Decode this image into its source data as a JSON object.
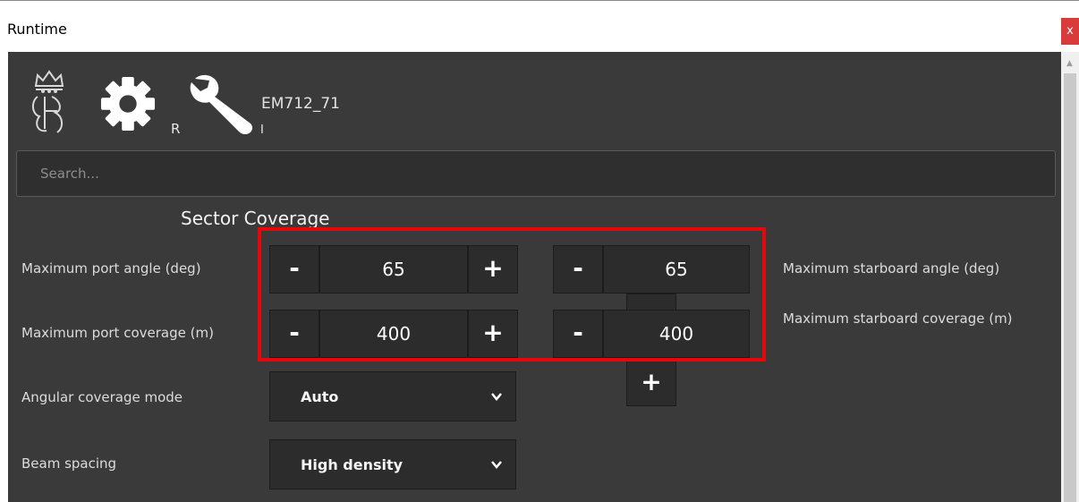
{
  "window": {
    "title": "Runtime",
    "close_label": "x"
  },
  "header": {
    "gear_sub": "R",
    "wrench_sub": "I",
    "device_name": "EM712_71"
  },
  "search": {
    "placeholder": "Search..."
  },
  "section": {
    "title": "Sector Coverage"
  },
  "port_angle": {
    "label": "Maximum port angle (deg)",
    "value": "65"
  },
  "starboard_angle": {
    "label": "Maximum starboard angle (deg)",
    "value": "65"
  },
  "port_coverage": {
    "label": "Maximum port coverage (m)",
    "value": "400"
  },
  "starboard_coverage": {
    "label": "Maximum starboard coverage (m)",
    "value": "400"
  },
  "angular_mode": {
    "label": "Angular coverage mode",
    "value": "Auto"
  },
  "beam_spacing": {
    "label": "Beam spacing",
    "value": "High density"
  },
  "buttons": {
    "minus": "-",
    "plus": "+"
  },
  "colors": {
    "panel": "#3a3a3a",
    "control": "#2c2c2c",
    "highlight": "#e5080b",
    "close": "#d93a3a"
  }
}
